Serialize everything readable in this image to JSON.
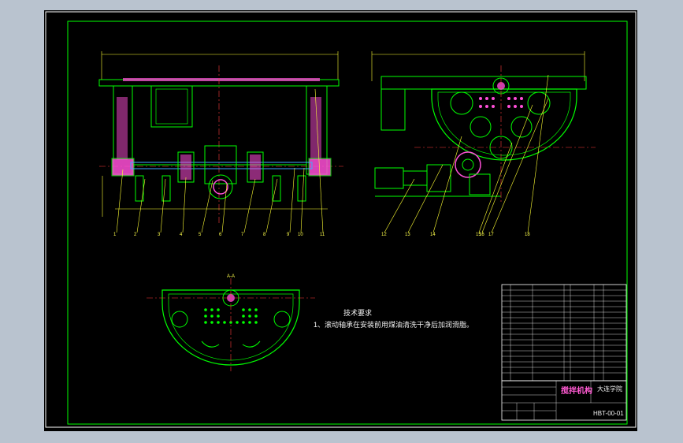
{
  "drawing": {
    "section_mark": "A-A",
    "tech_title": "技术要求",
    "tech_note": "1、滚动轴承在安装前用煤油清洗干净后加润滑脂。",
    "title_block": {
      "title": "搅拌机构",
      "school": "大连学院",
      "code": "HBT-00-01"
    },
    "balloons_left": [
      "1",
      "2",
      "3",
      "4",
      "5",
      "6",
      "7",
      "8",
      "9",
      "10",
      "11"
    ],
    "balloons_right": [
      "12",
      "13",
      "14",
      "15",
      "16",
      "17",
      "18"
    ]
  },
  "colors": {
    "background": "#000000",
    "frame": "#ffffff",
    "outline": "#00ff00",
    "hatch": "#ff4fd8",
    "centerline": "#ff3b3b",
    "dimension": "#ffff33",
    "shaft": "#3fa9ff"
  }
}
